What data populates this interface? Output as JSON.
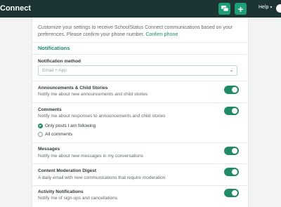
{
  "header": {
    "title": "Connect",
    "help_label": "Help",
    "icons": [
      "chat-icon",
      "plus-icon",
      "chevron-down-icon"
    ]
  },
  "intro": {
    "text": "Customize your settings to receive SchoolStatus Connect communications based on your preferences. Please confirm your phone number.",
    "link": "Confirm phone"
  },
  "notifications": {
    "section_title": "Notifications",
    "method_label": "Notification method",
    "method_value": "Email + App",
    "rows": [
      {
        "title": "Announcements & Child Stories",
        "desc": "Notify me about new announcements and child stories",
        "enabled": true
      },
      {
        "title": "Comments",
        "desc": "Notify me about responses to announcements and child stories",
        "enabled": true
      },
      {
        "title": "Messages",
        "desc": "Notify me about new messages in my conversations",
        "enabled": true
      },
      {
        "title": "Content Moderation Digest",
        "desc": "A daily email with new communications that require moderation",
        "enabled": true
      },
      {
        "title": "Activity Notifications",
        "desc": "Notify me of sign-ups and cancellations",
        "enabled": true
      }
    ],
    "comment_options": [
      {
        "label": "Only posts I am following",
        "selected": true
      },
      {
        "label": "All comments",
        "selected": false
      }
    ]
  },
  "colors": {
    "topbar": "#1c3534",
    "accent": "#1f8a64",
    "link": "#1b8a6e"
  }
}
